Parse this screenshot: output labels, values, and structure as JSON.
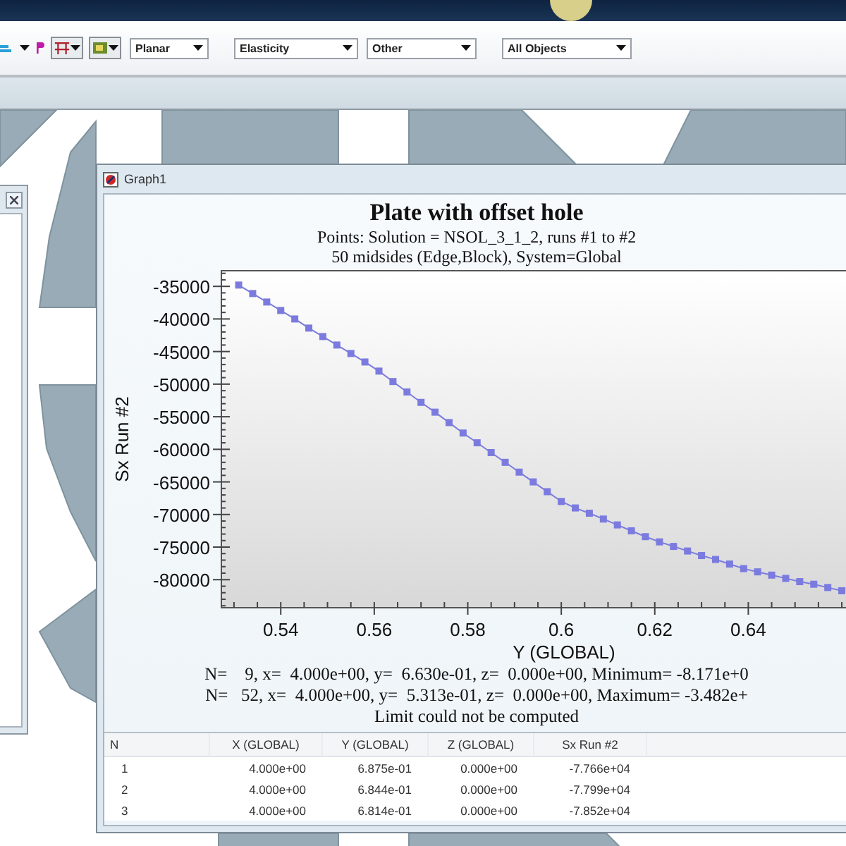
{
  "toolbar": {
    "dropdowns": [
      {
        "value": "Planar"
      },
      {
        "value": "Elasticity"
      },
      {
        "value": "Other"
      },
      {
        "value": "All Objects"
      }
    ]
  },
  "graph_window": {
    "title": "Graph1",
    "chart_title": "Plate with offset hole",
    "subtitles": [
      "Points: Solution = NSOL_3_1_2, runs #1 to #2",
      "50 midsides (Edge,Block), System=Global"
    ],
    "chart_data": {
      "type": "line",
      "xlabel": "Y (GLOBAL)",
      "ylabel": "Sx Run #2",
      "xlim": [
        0.5273,
        0.6615
      ],
      "ylim": [
        -84300,
        -32600
      ],
      "xticks": [
        0.54,
        0.56,
        0.58,
        0.6,
        0.62,
        0.64
      ],
      "yticks": [
        -35000,
        -40000,
        -45000,
        -50000,
        -55000,
        -60000,
        -65000,
        -70000,
        -75000,
        -80000
      ],
      "x": [
        0.531,
        0.534,
        0.537,
        0.54,
        0.543,
        0.546,
        0.549,
        0.552,
        0.555,
        0.558,
        0.561,
        0.564,
        0.567,
        0.57,
        0.573,
        0.576,
        0.579,
        0.582,
        0.585,
        0.588,
        0.591,
        0.594,
        0.597,
        0.6,
        0.603,
        0.606,
        0.609,
        0.612,
        0.615,
        0.618,
        0.621,
        0.624,
        0.627,
        0.63,
        0.633,
        0.636,
        0.639,
        0.642,
        0.645,
        0.648,
        0.651,
        0.654,
        0.657,
        0.66
      ],
      "series": [
        {
          "color": "#7b7bdf",
          "marker": "square",
          "values": [
            -34800,
            -36100,
            -37400,
            -38700,
            -40000,
            -41400,
            -42700,
            -44000,
            -45300,
            -46600,
            -48000,
            -49600,
            -51200,
            -52800,
            -54300,
            -55900,
            -57500,
            -59000,
            -60500,
            -62000,
            -63500,
            -65000,
            -66500,
            -68000,
            -69000,
            -69800,
            -70700,
            -71600,
            -72500,
            -73400,
            -74200,
            -74900,
            -75600,
            -76300,
            -76900,
            -77600,
            -78300,
            -78800,
            -79300,
            -79800,
            -80300,
            -80700,
            -81200,
            -81700
          ]
        }
      ]
    },
    "info_lines": [
      "N=    9, x=  4.000e+00, y=  6.630e-01, z=  0.000e+00, Minimum= -8.171e+0",
      "N=   52, x=  4.000e+00, y=  5.313e-01, z=  0.000e+00, Maximum= -3.482e+",
      "Limit could not be computed"
    ],
    "table": {
      "columns": [
        "N",
        "X (GLOBAL)",
        "Y (GLOBAL)",
        "Z (GLOBAL)",
        "Sx Run #2"
      ],
      "rows": [
        [
          "1",
          "4.000e+00",
          "6.875e-01",
          "0.000e+00",
          "-7.766e+04"
        ],
        [
          "2",
          "4.000e+00",
          "6.844e-01",
          "0.000e+00",
          "-7.799e+04"
        ],
        [
          "3",
          "4.000e+00",
          "6.814e-01",
          "0.000e+00",
          "-7.852e+04"
        ]
      ]
    }
  }
}
